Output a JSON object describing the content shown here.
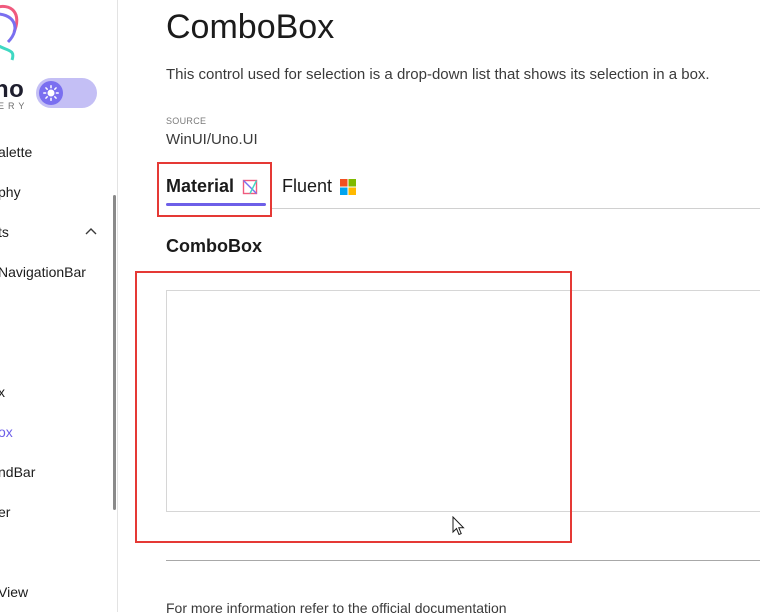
{
  "sidebar": {
    "logo_text": "no",
    "logo_subtext": "ERY",
    "items": [
      {
        "label": "alette",
        "selected": false
      },
      {
        "label": "phy",
        "selected": false
      },
      {
        "label": "ts",
        "selected": false,
        "expanded": true
      },
      {
        "label": "NavigationBar",
        "selected": false
      },
      {
        "label": "x",
        "selected": false
      },
      {
        "label": "ox",
        "selected": true
      },
      {
        "label": "ndBar",
        "selected": false
      },
      {
        "label": "er",
        "selected": false
      },
      {
        "label": "View",
        "selected": false
      }
    ]
  },
  "page": {
    "title": "ComboBox",
    "description": "This control used for selection is a drop-down list that shows its selection in a box.",
    "source_label": "SOURCE",
    "source_value": "WinUI/Uno.UI"
  },
  "tabs": [
    {
      "label": "Material",
      "icon": "material-icon",
      "active": true
    },
    {
      "label": "Fluent",
      "icon": "windows-logo-icon",
      "active": false
    }
  ],
  "section": {
    "title": "ComboBox"
  },
  "footer": {
    "text": "For more information refer to the  official documentation"
  },
  "colors": {
    "accent": "#6d5fe8",
    "highlight": "#e53935"
  }
}
